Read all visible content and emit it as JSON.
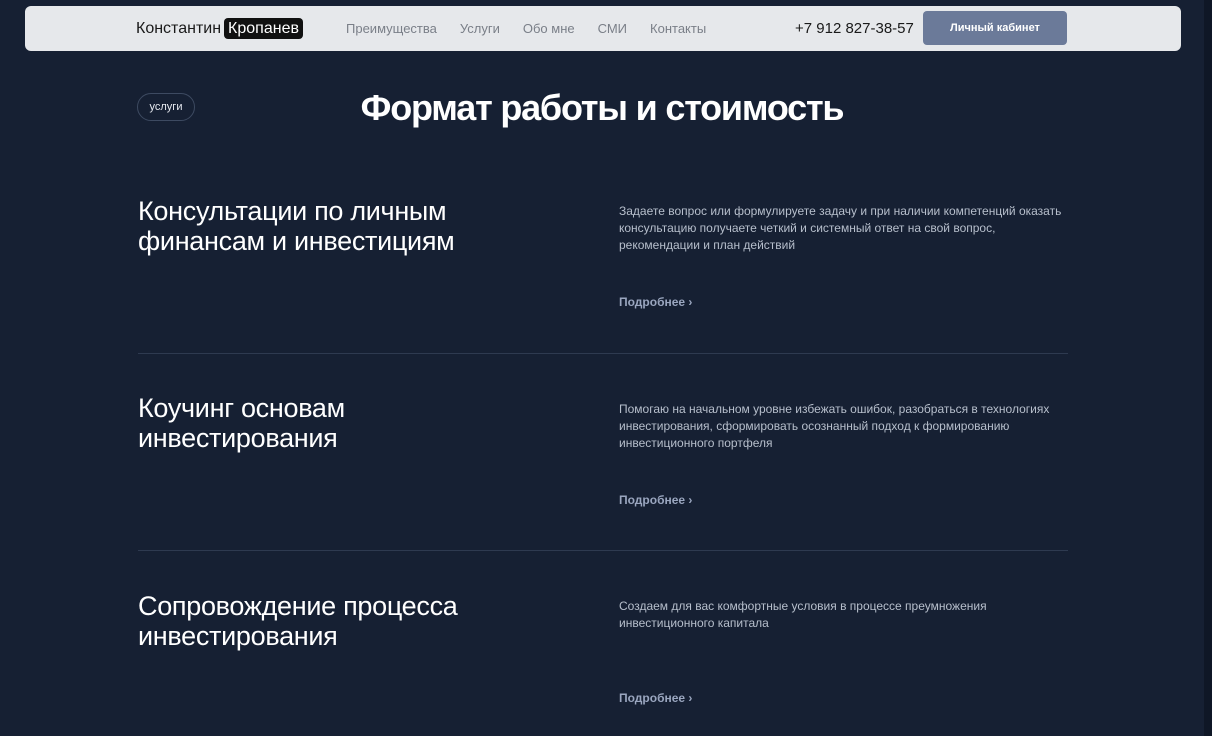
{
  "header": {
    "logo_first": "Константин",
    "logo_badge": "Кропанев",
    "nav": [
      "Преимущества",
      "Услуги",
      "Обо мне",
      "СМИ",
      "Контакты"
    ],
    "phone": "+7 912 827-38-57",
    "cabinet_button": "Личный кабинет"
  },
  "section": {
    "tag": "услуги",
    "title": "Формат работы и стоимость"
  },
  "services": [
    {
      "title_line1": "Консультации по личным",
      "title_line2": "финансам и инвестициям",
      "description": "Задаете вопрос или формулируете задачу и при наличии компетенций оказать консультацию получаете четкий и системный ответ на свой вопрос, рекомендации и план действий",
      "more": "Подробнее ›"
    },
    {
      "title_line1": "Коучинг основам",
      "title_line2": "инвестирования",
      "description": "Помогаю на начальном уровне избежать ошибок, разобраться в технологиях инвестирования, сформировать осознанный подход к формированию инвестиционного портфеля",
      "more": "Подробнее ›"
    },
    {
      "title_line1": "Сопровождение процесса",
      "title_line2": "инвестирования",
      "description": "Создаем для вас комфортные условия в процессе преумножения инвестиционного капитала",
      "more": "Подробнее ›"
    }
  ],
  "colors": {
    "background": "#162033",
    "header_bg": "#e6e8eb",
    "button_bg": "#6b7a99",
    "divider": "#2e3a50"
  }
}
